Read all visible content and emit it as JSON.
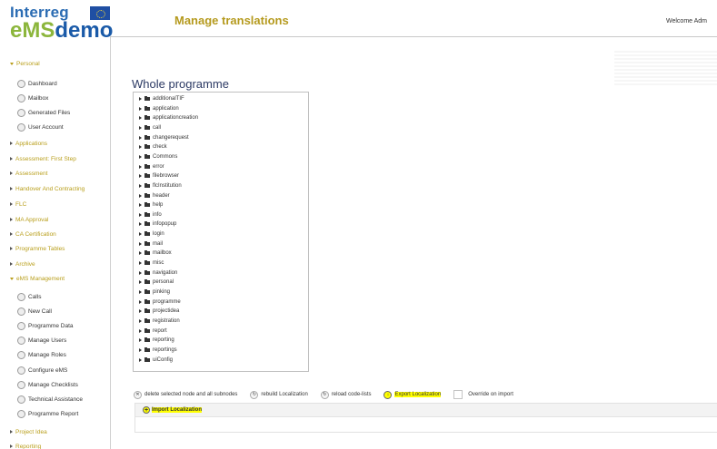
{
  "logo": {
    "top": "Interreg",
    "ems": "eMS",
    "demo": "demo"
  },
  "header": {
    "title": "Manage translations",
    "welcome": "Welcome Adm"
  },
  "sidebar": {
    "personal": "Personal",
    "personal_items": [
      {
        "label": "Dashboard",
        "icon": "dashboard-icon"
      },
      {
        "label": "Mailbox",
        "icon": "mailbox-icon"
      },
      {
        "label": "Generated Files",
        "icon": "files-icon"
      },
      {
        "label": "User Account",
        "icon": "user-icon"
      }
    ],
    "sections": [
      "Applications",
      "Assessment: First Step",
      "Assessment",
      "Handover And Contracting",
      "FLC",
      "MA Approval",
      "CA Certification",
      "Programme Tables",
      "Archive"
    ],
    "ems_management": "eMS Management",
    "ems_items": [
      {
        "label": "Calls",
        "icon": "calls-icon"
      },
      {
        "label": "New Call",
        "icon": "new-call-icon"
      },
      {
        "label": "Programme Data",
        "icon": "programme-data-icon"
      },
      {
        "label": "Manage Users",
        "icon": "users-icon"
      },
      {
        "label": "Manage Roles",
        "icon": "roles-icon"
      },
      {
        "label": "Configure eMS",
        "icon": "configure-icon"
      },
      {
        "label": "Manage Checklists",
        "icon": "checklist-icon"
      },
      {
        "label": "Technical Assistance",
        "icon": "assistance-icon"
      },
      {
        "label": "Programme Report",
        "icon": "report-icon"
      }
    ],
    "bottom_sections": [
      "Project Idea",
      "Reporting"
    ]
  },
  "main": {
    "heading": "Whole programme",
    "tree_nodes": [
      "additionalTIF",
      "application",
      "applicationcreation",
      "call",
      "changerequest",
      "check",
      "Commons",
      "error",
      "filebrowser",
      "flcInstitution",
      "header",
      "help",
      "info",
      "infopopup",
      "login",
      "mail",
      "mailbox",
      "misc",
      "navigation",
      "personal",
      "pinking",
      "programme",
      "projectidea",
      "registration",
      "report",
      "reporting",
      "reportings",
      "uiConfig"
    ],
    "actions": {
      "delete": "delete selected node and all subnodes",
      "rebuild": "rebuild Localization",
      "reload": "reload code-lists",
      "export": "Export Localization",
      "override": "Override on import",
      "import": "Import Localization"
    }
  },
  "colors": {
    "accent": "#b89e1a",
    "highlight": "#ffff00",
    "heading": "#2c3a64",
    "logo_green": "#8cb63c",
    "logo_blue": "#1a5aa8"
  }
}
